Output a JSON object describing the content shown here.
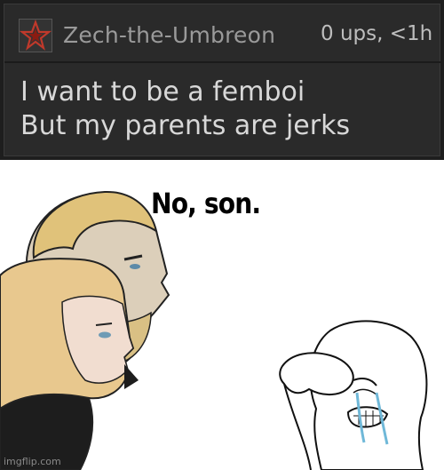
{
  "comment": {
    "username": "Zech-the-Umbreon",
    "meta": "0 ups, <1h",
    "lines": [
      "I want to be a femboi",
      "But my parents are jerks"
    ],
    "avatar_icon": "star-icon",
    "avatar_color": "#c0392b"
  },
  "meme": {
    "caption": "No, son.",
    "watermark": "imgflip.com"
  },
  "colors": {
    "panel_bg": "#2a2a2a",
    "username": "#9a9a9a",
    "meta": "#bdbdbd",
    "body_text": "#d8d8d8",
    "hair_blonde": "#e5c98a",
    "tears": "#6fb8d8"
  }
}
